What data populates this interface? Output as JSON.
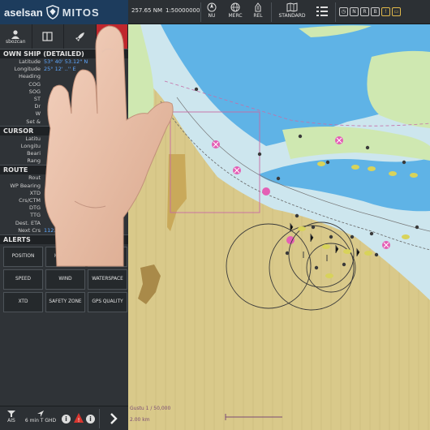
{
  "topbar": {
    "brand_name": "aselsan",
    "product_name": "MITOS",
    "range_readout": "257.65 NM",
    "scale_readout": "1:50000000",
    "buttons": [
      {
        "label": "NU",
        "icon": "compass-icon"
      },
      {
        "label": "MERC",
        "icon": "globe-icon"
      },
      {
        "label": "REL",
        "icon": "vessel-icon"
      },
      {
        "label": "STANDARD",
        "icon": "map-icon"
      },
      {
        "label": "",
        "icon": "list-icon"
      }
    ],
    "mini_icons": [
      "clock-icon",
      "n-icon",
      "r-icon",
      "b-icon",
      "warning-icon",
      "folder-icon"
    ]
  },
  "panel": {
    "tabs": [
      {
        "label": "sbozcan",
        "icon": "user-icon"
      },
      {
        "label": "",
        "icon": "layout-icon"
      },
      {
        "label": "",
        "icon": "rocket-icon"
      },
      {
        "label": "",
        "icon": "record-icon"
      }
    ],
    "own_ship": {
      "title": "OWN SHIP (DETAILED)",
      "rows": [
        {
          "k": "Latitude",
          "v": "53° 40' 53.12\" N"
        },
        {
          "k": "Longitude",
          "v": "25° 12' ..'' E"
        },
        {
          "k": "Heading",
          "v": ""
        },
        {
          "k": "COG",
          "v": ""
        },
        {
          "k": "SOG",
          "v": ""
        },
        {
          "k": "ST",
          "v": ""
        },
        {
          "k": "Dr",
          "v": ""
        },
        {
          "k": "W",
          "v": ""
        },
        {
          "k": "Set &",
          "v": ""
        }
      ]
    },
    "cursor": {
      "title": "CURSOR",
      "rows": [
        {
          "k": "Latitu",
          "v": ""
        },
        {
          "k": "Longitu",
          "v": ""
        },
        {
          "k": "Beari",
          "v": ""
        },
        {
          "k": "Rang",
          "v": ""
        }
      ]
    },
    "route": {
      "title": "ROUTE",
      "rows": [
        {
          "k": "Rout",
          "v": ""
        },
        {
          "k": "WP Bearing",
          "v": ""
        },
        {
          "k": "XTD",
          "v": ""
        },
        {
          "k": "Crs/CTM",
          "v": ""
        },
        {
          "k": "DTG",
          "v": ""
        },
        {
          "k": "TTG",
          "v": ""
        },
        {
          "k": "Dest. ETA",
          "v": ""
        },
        {
          "k": "Next Crs",
          "v": "112.4°T"
        }
      ]
    },
    "alerts": {
      "title": "ALERTS",
      "buttons": [
        "POSITION",
        "HEADING",
        "DEPTH",
        "SPEED",
        "WIND",
        "WATERSPACE",
        "XTD",
        "SAFETY ZONE",
        "GPS QUALITY"
      ]
    }
  },
  "bottombar": {
    "items": [
      {
        "label": "AIS",
        "icon": "filter-icon"
      },
      {
        "label": "6 min T GHD",
        "icon": "navigation-icon"
      }
    ]
  },
  "map": {
    "scale_label": "Gustu 1 / 50,000",
    "scale_distance": "2.00 km",
    "colors": {
      "land": "#d9c98a",
      "shallow_water": "#cde6ee",
      "deep_water": "#5fb3e6",
      "green_land": "#cfe8b1"
    }
  },
  "colors": {
    "brand_blue": "#1d3c5d",
    "panel_bg": "#2f3337",
    "value_blue": "#5fa8ff",
    "record_red": "#c0272d"
  }
}
